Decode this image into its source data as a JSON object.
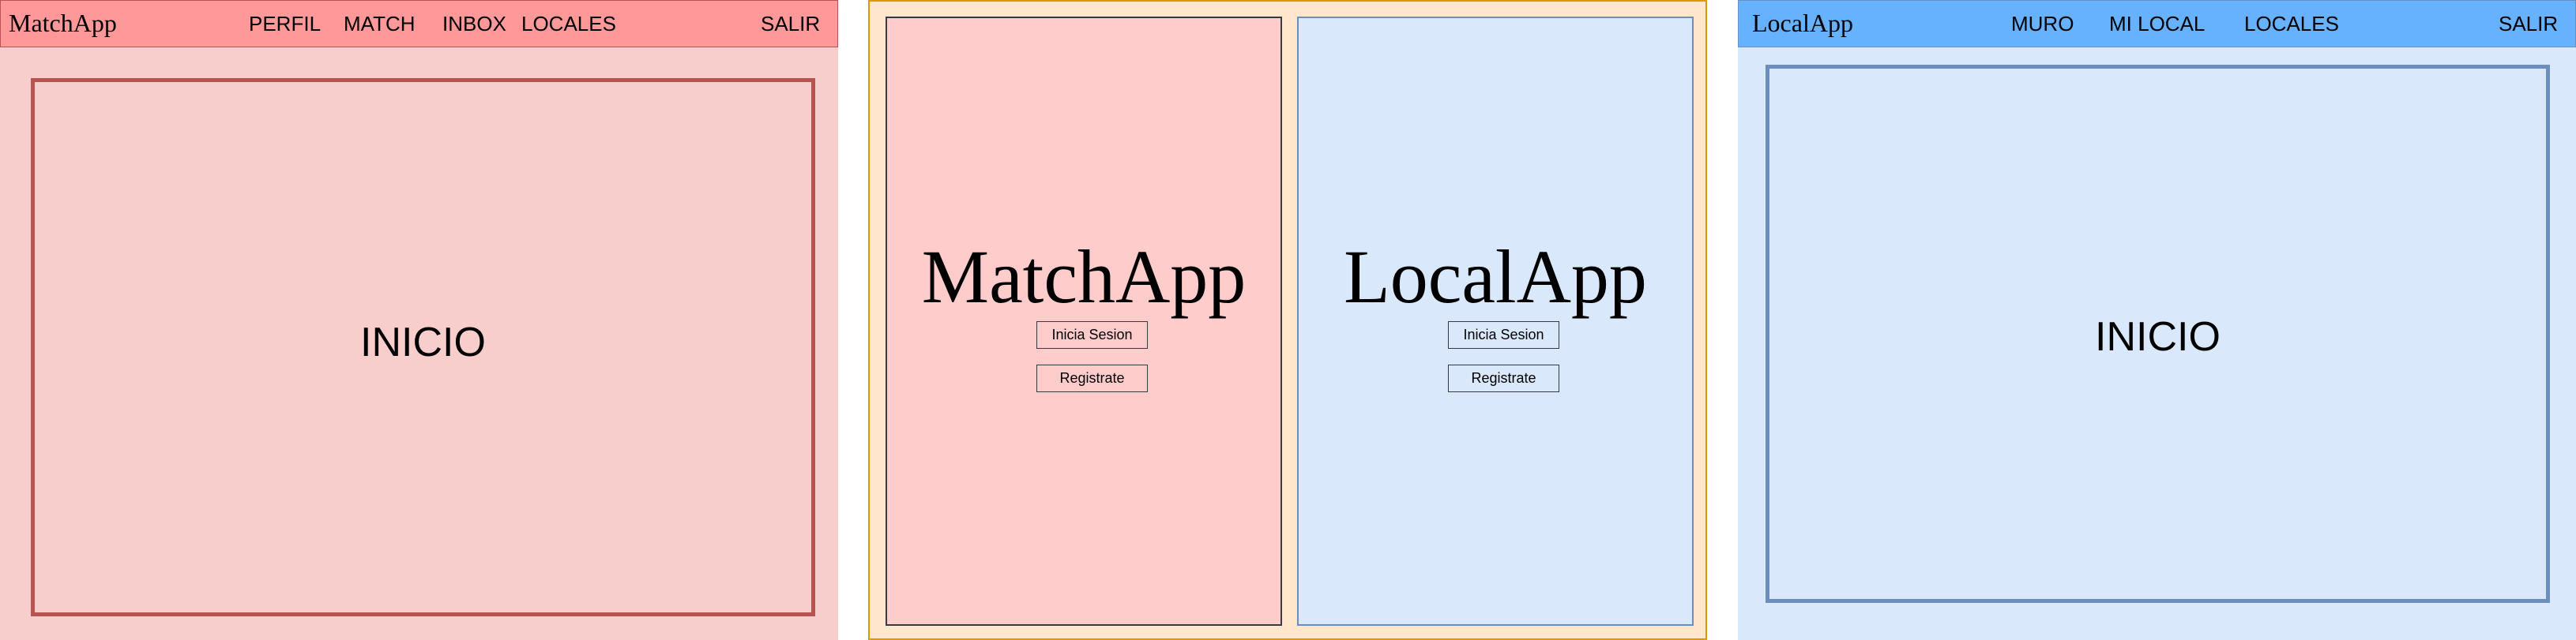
{
  "colors": {
    "match_bg": "#f8cecc",
    "match_nav": "#ff9999",
    "match_border": "#b85450",
    "login_bg": "#ffe6cc",
    "login_border": "#d79b00",
    "local_bg": "#dae8fc",
    "local_nav": "#66b2ff",
    "local_border": "#6c8ebf"
  },
  "match_home": {
    "brand": "MatchApp",
    "nav": [
      "PERFIL",
      "MATCH",
      "INBOX",
      "LOCALES"
    ],
    "logout": "SALIR",
    "content_title": "INICIO"
  },
  "login": {
    "match_title": "MatchApp",
    "local_title": "LocalApp",
    "login_label": "Inicia Sesion",
    "register_label": "Registrate"
  },
  "local_home": {
    "brand": "LocalApp",
    "nav": [
      "MURO",
      "MI LOCAL",
      "LOCALES"
    ],
    "logout": "SALIR",
    "content_title": "INICIO"
  }
}
